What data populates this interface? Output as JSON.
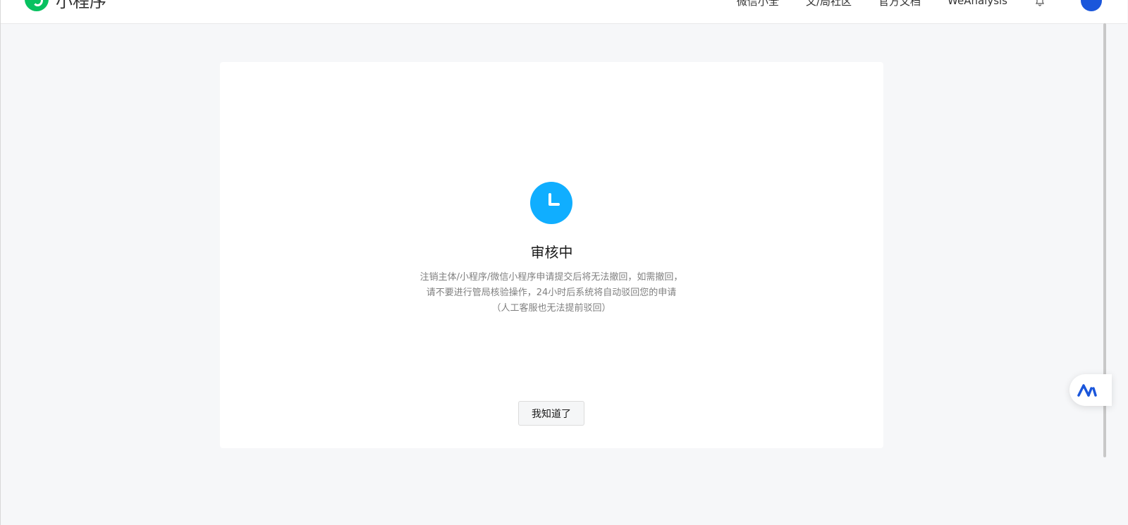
{
  "header": {
    "brand_name": "小程序",
    "nav_items": [
      "微信小全",
      "文/局社区",
      "官方文档",
      "WeAnalysis"
    ]
  },
  "dialog": {
    "status_title": "审核中",
    "status_description": "注销主体/小程序/微信小程序申请提交后将无法撤回，如需撤回，请不要进行管局核验操作，24小时后系统将自动驳回您的申请（人工客服也无法提前驳回）",
    "confirm_label": "我知道了"
  },
  "icons": {
    "status": "clock-icon",
    "notifications": "bell-icon",
    "assistant": "ai-assistant-icon"
  },
  "colors": {
    "brand": "#07c160",
    "status_icon": "#10aeff",
    "page_background": "#f6f7f9",
    "assistant": "#1a56db"
  }
}
